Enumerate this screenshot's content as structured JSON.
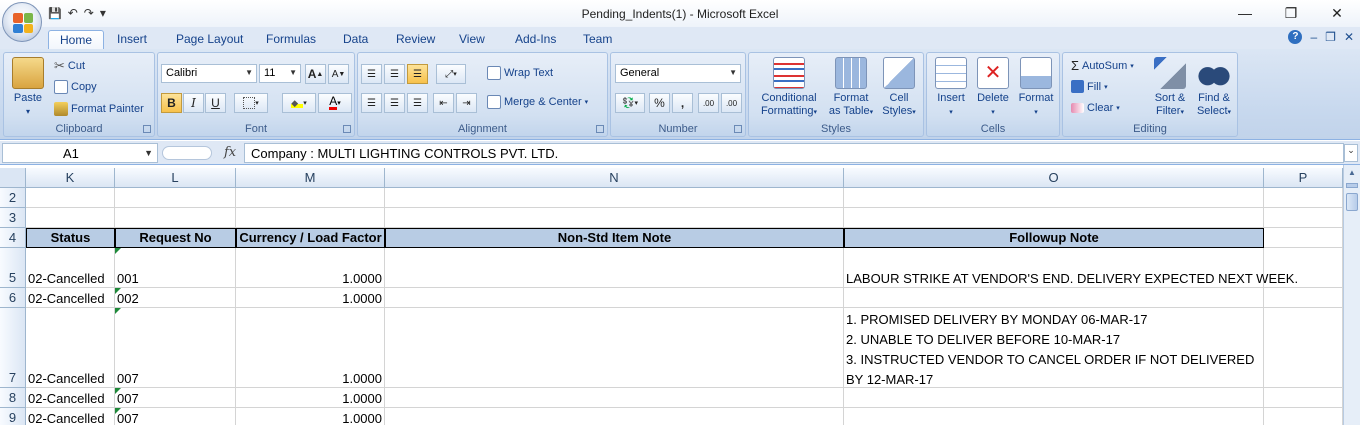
{
  "window": {
    "title": "Pending_Indents(1) - Microsoft Excel",
    "minimize": "—",
    "restore": "❐",
    "close": "✕"
  },
  "qat": {
    "save": "💾",
    "undo": "↶",
    "redo": "↷",
    "customize": "▾"
  },
  "tabs": [
    "Home",
    "Insert",
    "Page Layout",
    "Formulas",
    "Data",
    "Review",
    "View",
    "Add-Ins",
    "Team"
  ],
  "active_tab": "Home",
  "help": {
    "help": "?",
    "minimize": "–",
    "restore": "❐",
    "close": "✕"
  },
  "ribbon": {
    "clipboard": {
      "label": "Clipboard",
      "paste": "Paste",
      "cut": "Cut",
      "copy": "Copy",
      "format_painter": "Format Painter"
    },
    "font": {
      "label": "Font",
      "font_name": "Calibri",
      "font_size": "11",
      "grow": "A",
      "shrink": "A",
      "bold": "B",
      "italic": "I",
      "underline": "U",
      "font_color": "A"
    },
    "alignment": {
      "label": "Alignment",
      "wrap_text": "Wrap Text",
      "merge_center": "Merge & Center"
    },
    "number": {
      "label": "Number",
      "format": "General",
      "percent": "%",
      "comma": ",",
      "inc_decimal": ".00",
      "dec_decimal": ".00"
    },
    "styles": {
      "label": "Styles",
      "conditional": "Conditional",
      "conditional2": "Formatting",
      "format_table": "Format",
      "format_table2": "as Table",
      "cell_styles": "Cell",
      "cell_styles2": "Styles"
    },
    "cells": {
      "label": "Cells",
      "insert": "Insert",
      "delete": "Delete",
      "format": "Format"
    },
    "editing": {
      "label": "Editing",
      "autosum": "AutoSum",
      "fill": "Fill",
      "clear": "Clear",
      "sort": "Sort &",
      "sort2": "Filter",
      "find": "Find &",
      "find2": "Select"
    }
  },
  "formula_bar": {
    "name_box": "A1",
    "fx": "fx",
    "content": "Company : MULTI LIGHTING CONTROLS PVT. LTD."
  },
  "columns": [
    "K",
    "L",
    "M",
    "N",
    "O",
    "P"
  ],
  "rows": [
    "2",
    "3",
    "4",
    "5",
    "6",
    "7",
    "8",
    "9"
  ],
  "table": {
    "headers": [
      "Status",
      "Request No",
      "Currency / Load Factor",
      "Non-Std Item Note",
      "Followup Note"
    ],
    "rows": [
      {
        "status": "02-Cancelled",
        "request_no": "001",
        "factor": "1.0000",
        "note": "",
        "followup": "LABOUR STRIKE AT VENDOR'S END. DELIVERY EXPECTED NEXT WEEK."
      },
      {
        "status": "02-Cancelled",
        "request_no": "002",
        "factor": "1.0000",
        "note": "",
        "followup": ""
      },
      {
        "status": "02-Cancelled",
        "request_no": "007",
        "factor": "1.0000",
        "note": "",
        "followup": "1. PROMISED DELIVERY BY MONDAY 06-MAR-17\n2. UNABLE TO DELIVER BEFORE 10-MAR-17\n3. INSTRUCTED VENDOR TO CANCEL ORDER IF NOT DELIVERED BY 12-MAR-17"
      },
      {
        "status": "02-Cancelled",
        "request_no": "007",
        "factor": "1.0000",
        "note": "",
        "followup": ""
      },
      {
        "status": "02-Cancelled",
        "request_no": "007",
        "factor": "1.0000",
        "note": "",
        "followup": ""
      }
    ]
  }
}
